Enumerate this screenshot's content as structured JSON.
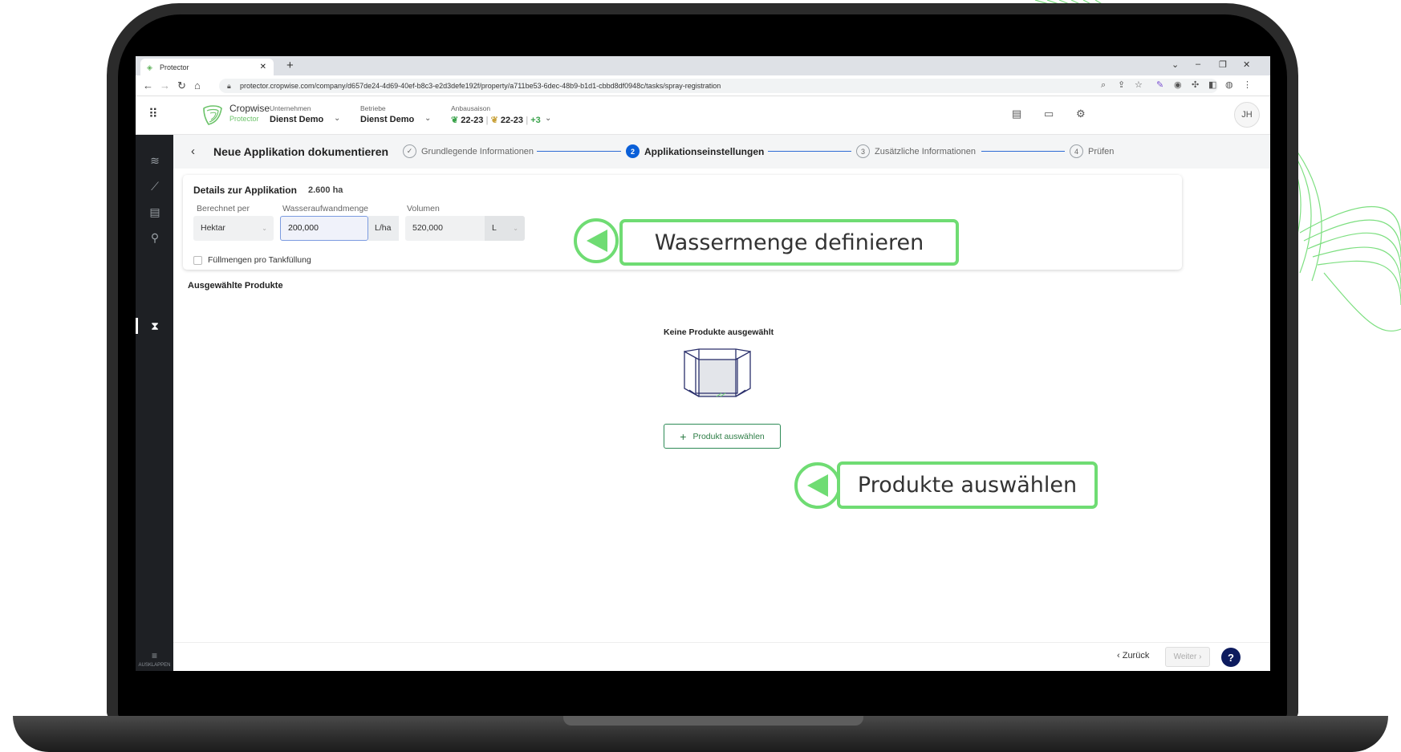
{
  "browser": {
    "tab_title": "Protector",
    "new_tab": "+",
    "url": "protector.cropwise.com/company/d657de24-4d69-40ef-b8c3-e2d3defe192f/property/a711be53-6dec-48b9-b1d1-cbbd8df0948c/tasks/spray-registration"
  },
  "header": {
    "brand_name": "Cropwise",
    "brand_sub": "Protector",
    "company_label": "Unternehmen",
    "company_value": "Dienst Demo",
    "farm_label": "Betriebe",
    "farm_value": "Dienst Demo",
    "season_label": "Anbausaison",
    "season_a": "22-23",
    "season_b": "22-23",
    "season_more": "+3",
    "avatar_initials": "JH"
  },
  "sidebar": {
    "collapse_label": "AUSKLAPPEN"
  },
  "wizard": {
    "title": "Neue Applikation dokumentieren",
    "steps": [
      {
        "number": "✓",
        "label": "Grundlegende Informationen",
        "state": "done"
      },
      {
        "number": "2",
        "label": "Applikationseinstellungen",
        "state": "active"
      },
      {
        "number": "3",
        "label": "Zusätzliche Informationen",
        "state": "pending"
      },
      {
        "number": "4",
        "label": "Prüfen",
        "state": "pending"
      }
    ]
  },
  "details": {
    "title": "Details zur Applikation",
    "area": "2.600 ha",
    "calc_label": "Berechnet per",
    "calc_value": "Hektar",
    "water_label": "Wasseraufwandmenge",
    "water_value": "200,000",
    "water_unit": "L/ha",
    "volume_label": "Volumen",
    "volume_value": "520,000",
    "volume_unit": "L",
    "checkbox_label": "Füllmengen pro Tankfüllung"
  },
  "products": {
    "section_title": "Ausgewählte Produkte",
    "empty_title": "Keine Produkte ausgewählt",
    "add_button": "Produkt auswählen"
  },
  "footer": {
    "back_label": "‹ Zurück",
    "next_label": "Weiter ›",
    "help_label": "?"
  },
  "callouts": {
    "water": "Wassermenge definieren",
    "products": "Produkte auswählen"
  },
  "colors": {
    "accent_green": "#6fdc73",
    "step_active_blue": "#0a5fd8",
    "help_navy": "#0d1b5e",
    "sidebar_bg": "#1e2024"
  }
}
